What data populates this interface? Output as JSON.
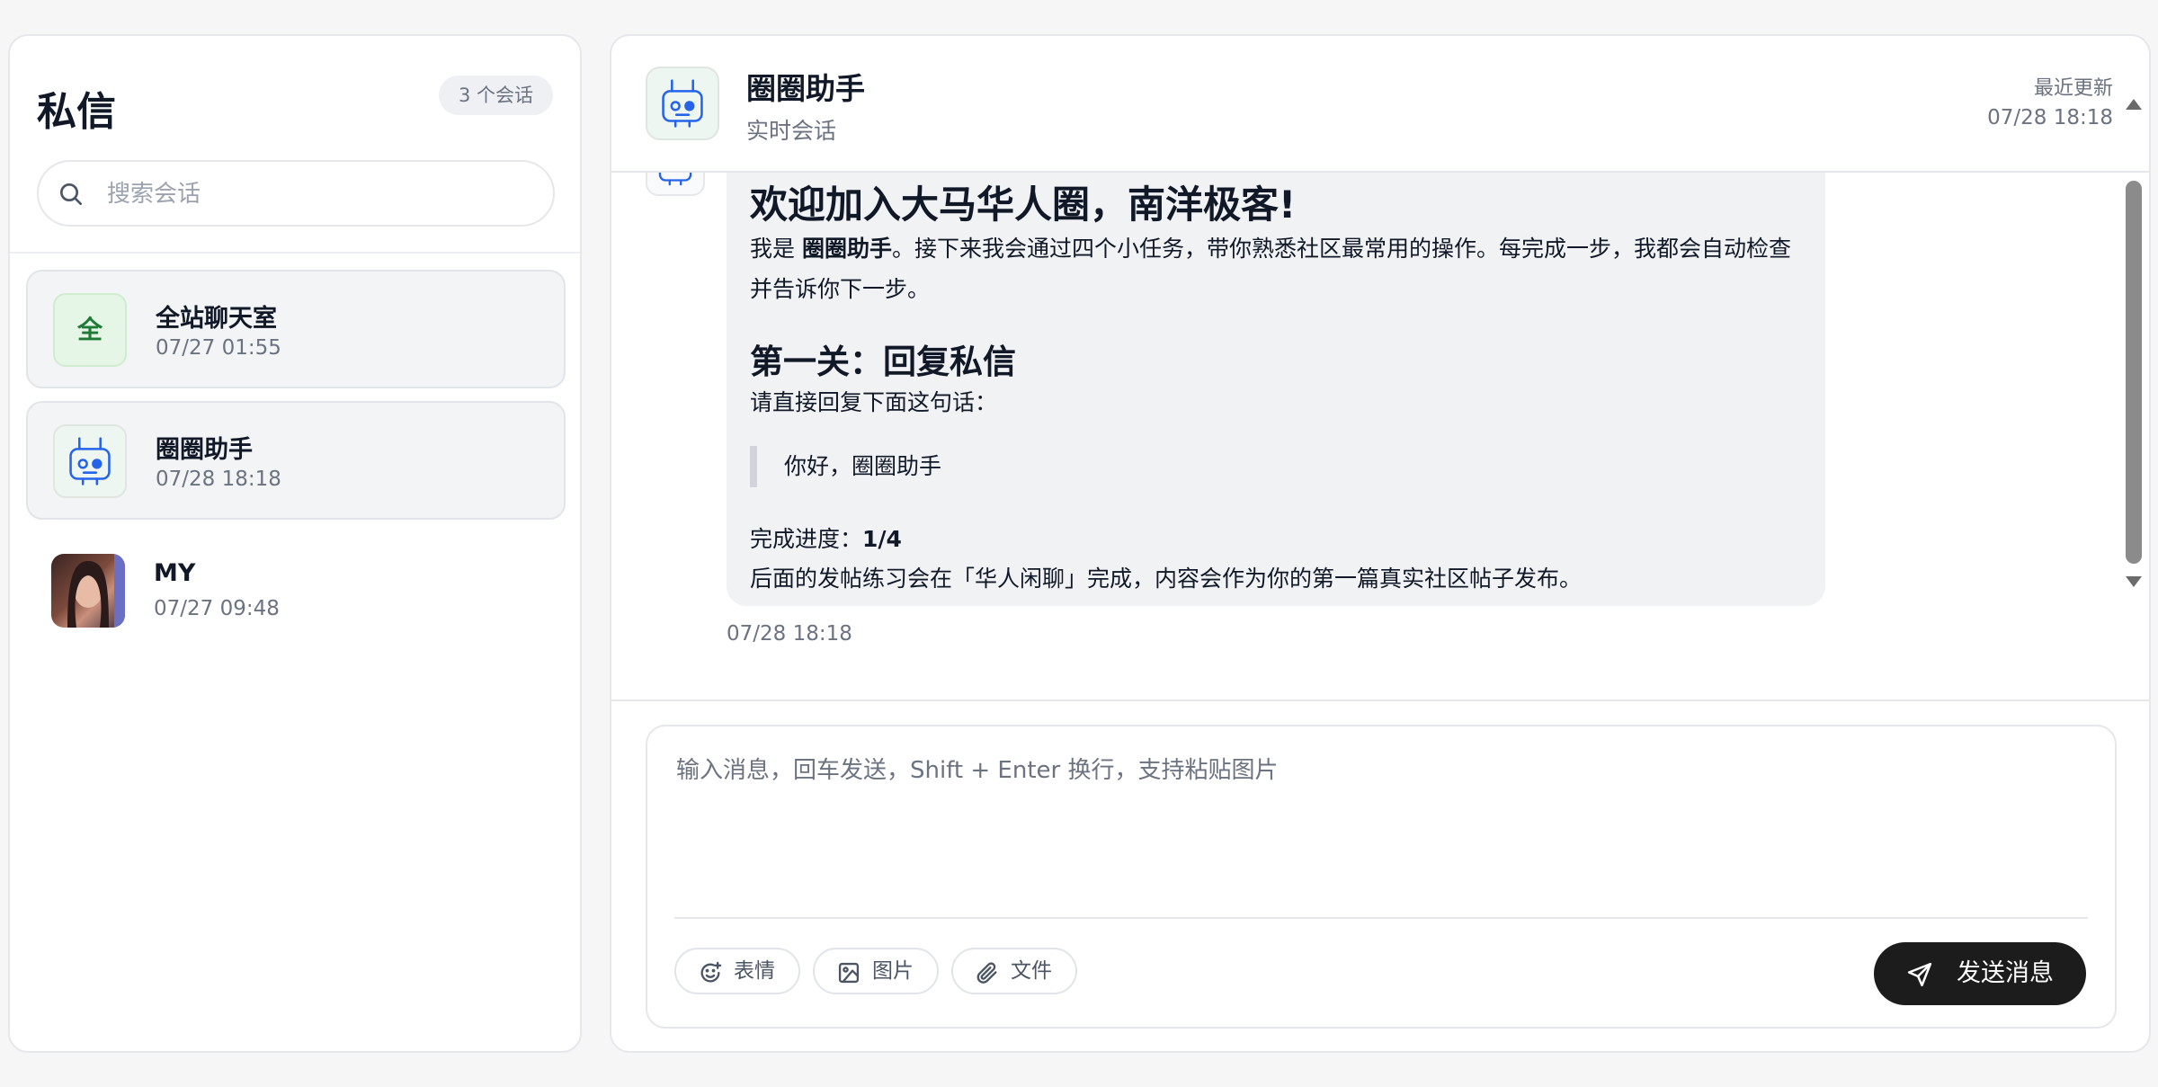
{
  "sidebar": {
    "title": "私信",
    "count_badge": "3 个会话",
    "search_placeholder": "搜索会话",
    "conversations": [
      {
        "avatar_text": "全",
        "name": "全站聊天室",
        "time": "07/27 01:55",
        "avatar": "green-letter"
      },
      {
        "avatar_text": "",
        "name": "圈圈助手",
        "time": "07/28 18:18",
        "avatar": "robot-icon",
        "selected": true
      },
      {
        "avatar_text": "",
        "name": "MY",
        "time": "07/27 09:48",
        "avatar": "user-photo"
      }
    ]
  },
  "chat": {
    "header": {
      "name": "圈圈助手",
      "subtitle": "实时会话",
      "updated_label": "最近更新",
      "updated_time": "07/28 18:18"
    },
    "message": {
      "h1": "欢迎加入大马华人圈，南洋极客!",
      "intro_prefix": "我是 ",
      "intro_bold": "圈圈助手",
      "intro_rest": "。接下来我会通过四个小任务，带你熟悉社区最常用的操作。每完成一步，我都会自动检查并告诉你下一步。",
      "h2": "第一关：回复私信",
      "instruction": "请直接回复下面这句话：",
      "quote": "你好，圈圈助手",
      "progress_label": "完成进度：",
      "progress_value": "1/4",
      "note": "后面的发帖练习会在「华人闲聊」完成，内容会作为你的第一篇真实社区帖子发布。",
      "time": "07/28 18:18"
    },
    "composer": {
      "placeholder": "输入消息，回车发送，Shift + Enter 换行，支持粘贴图片",
      "tools": [
        {
          "label": "表情",
          "icon": "emoji-icon"
        },
        {
          "label": "图片",
          "icon": "image-icon"
        },
        {
          "label": "文件",
          "icon": "paperclip-icon"
        }
      ],
      "send_label": "发送消息"
    }
  },
  "colors": {
    "accent_dark": "#1c1c1c",
    "robot_blue": "#2563eb",
    "green_avatar": "#1f7a36"
  }
}
